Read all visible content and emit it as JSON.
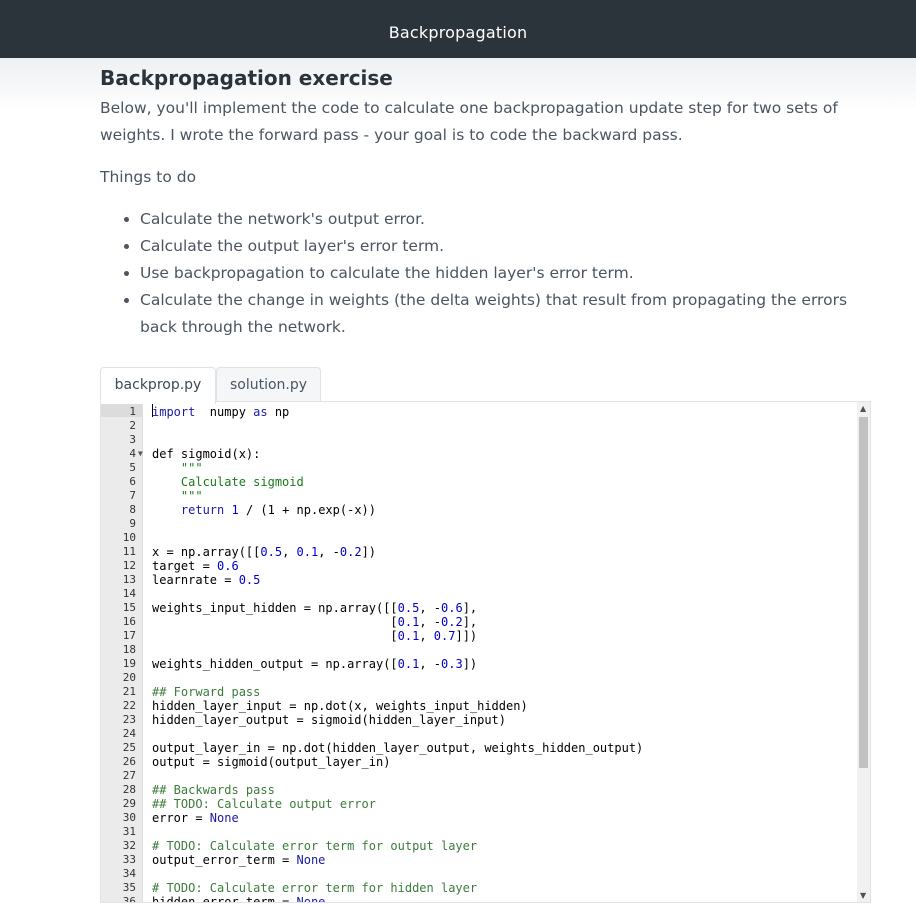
{
  "header": {
    "title": "Backpropagation"
  },
  "main": {
    "heading": "Backpropagation exercise",
    "intro": "Below, you'll implement the code to calculate one backpropagation update step for two sets of weights. I wrote the forward pass - your goal is to code the backward pass.",
    "things_label": "Things to do",
    "todo": [
      "Calculate the network's output error.",
      "Calculate the output layer's error term.",
      "Use backpropagation to calculate the hidden layer's error term.",
      "Calculate the change in weights (the delta weights) that result from propagating the errors back through the network."
    ]
  },
  "editor": {
    "tabs": [
      {
        "label": "backprop.py",
        "active": true
      },
      {
        "label": "solution.py",
        "active": false
      }
    ],
    "lines": [
      [
        [
          "kw",
          "import"
        ],
        [
          "",
          "  numpy "
        ],
        [
          "kw",
          "as"
        ],
        [
          "",
          " np"
        ]
      ],
      [],
      [],
      [
        [
          "",
          "def sigmoid(x):"
        ]
      ],
      [
        [
          "str",
          "    \"\"\""
        ]
      ],
      [
        [
          "str",
          "    Calculate sigmoid"
        ]
      ],
      [
        [
          "str",
          "    \"\"\""
        ]
      ],
      [
        [
          "kw",
          "    return "
        ],
        [
          "num",
          "1"
        ],
        [
          "",
          " / (1 + np.exp(-x))"
        ]
      ],
      [],
      [],
      [
        [
          "",
          "x = np.array([["
        ],
        [
          "num",
          "0.5"
        ],
        [
          "",
          ", "
        ],
        [
          "num",
          "0.1"
        ],
        [
          "",
          ", -"
        ],
        [
          "num",
          "0.2"
        ],
        [
          "",
          "])"
        ]
      ],
      [
        [
          "",
          "target = "
        ],
        [
          "num",
          "0.6"
        ]
      ],
      [
        [
          "",
          "learnrate = "
        ],
        [
          "num",
          "0.5"
        ]
      ],
      [],
      [
        [
          "",
          "weights_input_hidden = np.array([["
        ],
        [
          "num",
          "0.5"
        ],
        [
          "",
          ", -"
        ],
        [
          "num",
          "0.6"
        ],
        [
          "",
          "],"
        ]
      ],
      [
        [
          "",
          "                                 ["
        ],
        [
          "num",
          "0.1"
        ],
        [
          "",
          ", -"
        ],
        [
          "num",
          "0.2"
        ],
        [
          "",
          "],"
        ]
      ],
      [
        [
          "",
          "                                 ["
        ],
        [
          "num",
          "0.1"
        ],
        [
          "",
          ", "
        ],
        [
          "num",
          "0.7"
        ],
        [
          "",
          "]])"
        ]
      ],
      [],
      [
        [
          "",
          "weights_hidden_output = np.array(["
        ],
        [
          "num",
          "0.1"
        ],
        [
          "",
          ", -"
        ],
        [
          "num",
          "0.3"
        ],
        [
          "",
          "])"
        ]
      ],
      [],
      [
        [
          "com",
          "## Forward pass"
        ]
      ],
      [
        [
          "",
          "hidden_layer_input = np.dot(x, weights_input_hidden)"
        ]
      ],
      [
        [
          "",
          "hidden_layer_output = sigmoid(hidden_layer_input)"
        ]
      ],
      [],
      [
        [
          "",
          "output_layer_in = np.dot(hidden_layer_output, weights_hidden_output)"
        ]
      ],
      [
        [
          "",
          "output = sigmoid(output_layer_in)"
        ]
      ],
      [],
      [
        [
          "com",
          "## Backwards pass"
        ]
      ],
      [
        [
          "com",
          "## TODO: Calculate output error"
        ]
      ],
      [
        [
          "",
          "error = "
        ],
        [
          "kw",
          "None"
        ]
      ],
      [],
      [
        [
          "com",
          "# TODO: Calculate error term for output layer"
        ]
      ],
      [
        [
          "",
          "output_error_term = "
        ],
        [
          "kw",
          "None"
        ]
      ],
      [],
      [
        [
          "com",
          "# TODO: Calculate error term for hidden layer"
        ]
      ],
      [
        [
          "",
          "hidden_error_term = "
        ],
        [
          "kw",
          "None"
        ]
      ]
    ]
  }
}
